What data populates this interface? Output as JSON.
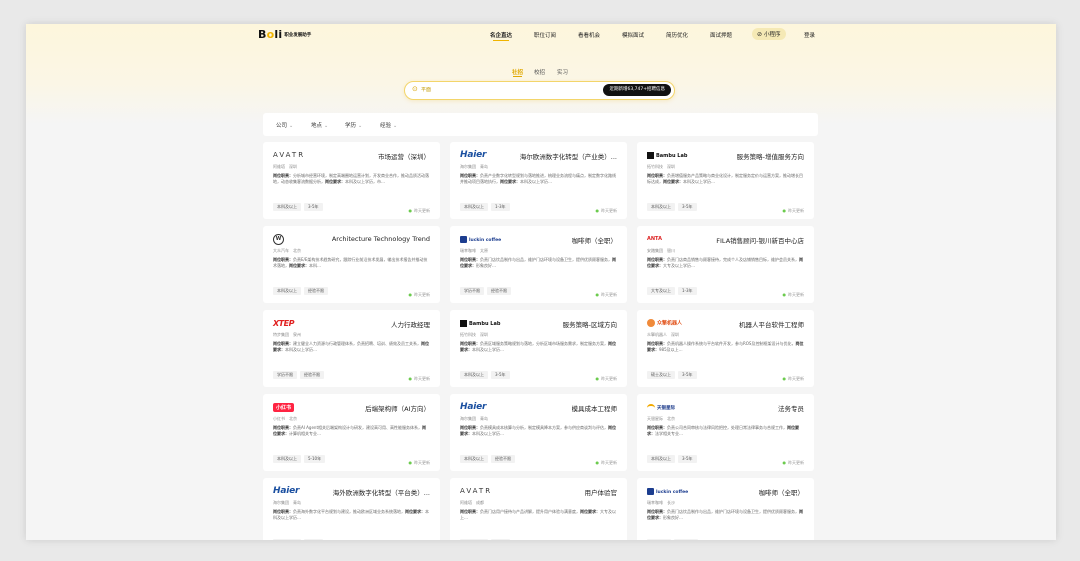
{
  "brand": {
    "logo": "Boli",
    "tagline": "职业发展助手"
  },
  "nav": {
    "items": [
      "名企直达",
      "职位订阅",
      "看看机会",
      "模拟面试",
      "简历优化",
      "面试押题"
    ],
    "active": "名企直达",
    "mini_program": "小程序",
    "login": "登录"
  },
  "modes": {
    "items": [
      "社招",
      "校招",
      "实习"
    ],
    "active": "社招"
  },
  "search": {
    "placeholder": "平面",
    "button": "近期新增63,747+招聘信息"
  },
  "filters": [
    "公司",
    "地点",
    "学历",
    "经验"
  ],
  "colors": {
    "accent": "#f0b400",
    "hero_bg": "#fdf6dc",
    "tag_bg": "#f2f2f2",
    "status_dot": "#6ccb4e"
  },
  "cards": [
    {
      "brand": "AVATR",
      "brand_type": "avatr",
      "title": "市场运营（深圳）",
      "sub": "阿维塔　深圳",
      "duty_label": "岗位职责：",
      "duty": "分析城市经营环境，制定高端圈地运营计划，开发商业合作，推动品质活动落地，动态收集客流数据分析，",
      "req_label": "岗位要求：",
      "req": "本科及以上学历，市…",
      "tags": [
        "本科及以上",
        "3-5年"
      ],
      "time": "昨天更新"
    },
    {
      "brand": "Haier",
      "brand_type": "haier",
      "title": "海尔欧洲数字化转型（产业类）...",
      "sub": "海尔集团　青岛",
      "duty_label": "岗位职责：",
      "duty": "负责产业数字化转型规划与落地推进，梳理业务流程与痛点，制定数字化路线并推动项目落地执行，",
      "req_label": "岗位要求：",
      "req": "本科及以上学历…",
      "tags": [
        "本科及以上",
        "1-3年"
      ],
      "time": "昨天更新"
    },
    {
      "brand": "Bambu Lab",
      "brand_type": "bambu",
      "title": "服务策略-增值服务方向",
      "sub": "拓竹科技　深圳",
      "duty_label": "岗位职责：",
      "duty": "负责增值服务产品策略与商业化设计，制定服务定价与运营方案，推动增长目标达成，",
      "req_label": "岗位要求：",
      "req": "本科及以上学历…",
      "tags": [
        "本科及以上",
        "3-5年"
      ],
      "time": "昨天更新"
    },
    {
      "brand": "VW",
      "brand_type": "vw",
      "title": "Architecture Technology Trend",
      "sub": "大众汽车　北京",
      "duty_label": "岗位职责：",
      "duty": "负责E/E架构技术趋势研究，跟踪行业前沿技术发展，输出技术报告并推动技术落地，",
      "req_label": "岗位要求：",
      "req": "本科…",
      "tags": [
        "本科及以上",
        "经验不限"
      ],
      "time": "昨天更新"
    },
    {
      "brand": "luckin coffee",
      "brand_type": "luckin",
      "title": "咖啡师（全职）",
      "sub": "瑞幸咖啡　太原",
      "duty_label": "岗位职责：",
      "duty": "负责门店饮品制作与出品，维护门店环境与设备卫生，提供优质顾客服务，",
      "req_label": "岗位要求：",
      "req": "形象良好…",
      "tags": [
        "学历不限",
        "经验不限"
      ],
      "time": "昨天更新"
    },
    {
      "brand": "ANTA",
      "brand_type": "anta",
      "title": "FILA销售顾问-银川新百中心店",
      "sub": "安踏集团　银川",
      "duty_label": "岗位职责：",
      "duty": "负责门店商品销售与顾客接待，完成个人及店铺销售目标，维护会员关系，",
      "req_label": "岗位要求：",
      "req": "大专及以上学历…",
      "tags": [
        "大专及以上",
        "1-3年"
      ],
      "time": "昨天更新"
    },
    {
      "brand": "XTEP",
      "brand_type": "xtep",
      "title": "人力行政经理",
      "sub": "特步集团　泉州",
      "duty_label": "岗位职责：",
      "duty": "建立健全人力资源与行政管理体系，负责招聘、培训、绩效及员工关系，",
      "req_label": "岗位要求：",
      "req": "本科及以上学历…",
      "tags": [
        "学历不限",
        "经验不限"
      ],
      "time": "昨天更新"
    },
    {
      "brand": "Bambu Lab",
      "brand_type": "bambu",
      "title": "服务策略-区域方向",
      "sub": "拓竹科技　深圳",
      "duty_label": "岗位职责：",
      "duty": "负责区域服务策略规划与落地，分析区域市场服务需求，制定服务方案，",
      "req_label": "岗位要求：",
      "req": "本科及以上学历…",
      "tags": [
        "本科及以上",
        "3-5年"
      ],
      "time": "昨天更新"
    },
    {
      "brand": "众擎机器人",
      "brand_type": "robot",
      "title": "机器人平台软件工程师",
      "sub": "众擎机器人　深圳",
      "duty_label": "岗位职责：",
      "duty": "负责机器人操作系统与平台软件开发，参与ROS及控制框架设计与优化，",
      "req_label": "岗位要求：",
      "req": "985及以上…",
      "tags": [
        "硕士及以上",
        "3-5年"
      ],
      "time": "昨天更新"
    },
    {
      "brand": "小红书",
      "brand_type": "xhs",
      "title": "后端架构师（AI方向）",
      "sub": "小红书　北京",
      "duty_label": "岗位职责：",
      "duty": "负责AI Agent相关后端架构设计与研发，建设高可用、高性能服务体系，",
      "req_label": "岗位要求：",
      "req": "计算机相关专业…",
      "tags": [
        "本科及以上",
        "5-10年"
      ],
      "time": "昨天更新"
    },
    {
      "brand": "Haier",
      "brand_type": "haier",
      "title": "模具成本工程师",
      "sub": "海尔集团　青岛",
      "duty_label": "岗位职责：",
      "duty": "负责模具成本核算与分析，制定模具降本方案，参与供应商谈判与评估，",
      "req_label": "岗位要求：",
      "req": "本科及以上学历…",
      "tags": [
        "本科及以上",
        "经验不限"
      ],
      "time": "昨天更新"
    },
    {
      "brand": "天银星际",
      "brand_type": "sky",
      "title": "法务专员",
      "sub": "天银星际　北京",
      "duty_label": "岗位职责：",
      "duty": "负责公司合同审核与法律风险把控，处理日常法律事务与合规工作，",
      "req_label": "岗位要求：",
      "req": "法学相关专业…",
      "tags": [
        "本科及以上",
        "3-5年"
      ],
      "time": "昨天更新"
    },
    {
      "brand": "Haier",
      "brand_type": "haier",
      "title": "海外欧洲数字化转型（平台类）...",
      "sub": "海尔集团　青岛",
      "duty_label": "岗位职责：",
      "duty": "负责海外数字化平台规划与建设，推动欧洲区域业务系统落地，",
      "req_label": "岗位要求：",
      "req": "本科及以上学历…",
      "tags": [
        "本科及以上",
        "3-5年"
      ],
      "time": "昨天更新"
    },
    {
      "brand": "AVATR",
      "brand_type": "avatr",
      "title": "用户体验官",
      "sub": "阿维塔　成都",
      "duty_label": "岗位职责：",
      "duty": "负责门店用户接待与产品讲解，提升用户体验与满意度，",
      "req_label": "岗位要求：",
      "req": "大专及以上…",
      "tags": [
        "本科及以上",
        "3-5年"
      ],
      "time": "昨天更新"
    },
    {
      "brand": "luckin coffee",
      "brand_type": "luckin",
      "title": "咖啡师（全职）",
      "sub": "瑞幸咖啡　长沙",
      "duty_label": "岗位职责：",
      "duty": "负责门店饮品制作与出品，维护门店环境与设备卫生，提供优质顾客服务，",
      "req_label": "岗位要求：",
      "req": "形象良好…",
      "tags": [
        "学历不限",
        "经验不限"
      ],
      "time": "昨天更新"
    }
  ]
}
